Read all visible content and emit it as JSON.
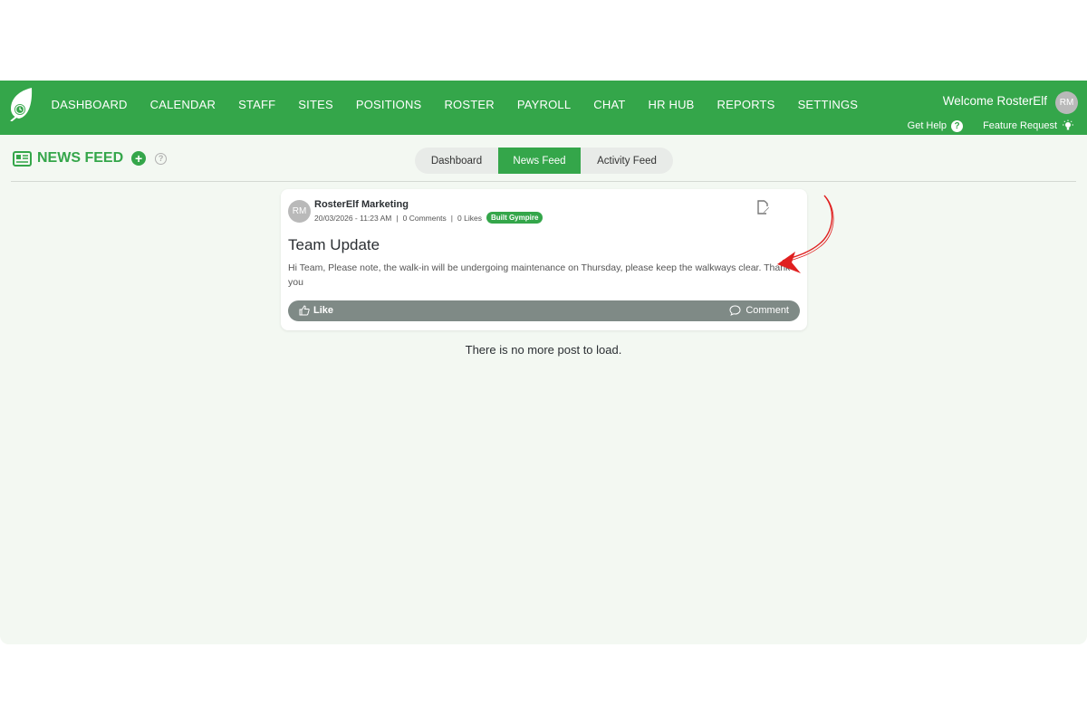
{
  "nav": {
    "items": [
      "DASHBOARD",
      "CALENDAR",
      "STAFF",
      "SITES",
      "POSITIONS",
      "ROSTER",
      "PAYROLL",
      "CHAT",
      "HR HUB",
      "REPORTS",
      "SETTINGS"
    ]
  },
  "user": {
    "welcome": "Welcome RosterElf",
    "initials": "RM"
  },
  "help": {
    "get_help": "Get Help",
    "feature_request": "Feature Request"
  },
  "page": {
    "title": "NEWS FEED"
  },
  "tabs": [
    "Dashboard",
    "News Feed",
    "Activity Feed"
  ],
  "post": {
    "avatar_initials": "RM",
    "author": "RosterElf Marketing",
    "date": "20/03/2026 - 11:23 AM",
    "comments": "0 Comments",
    "likes": "0 Likes",
    "site_badge": "Built Gympire",
    "title": "Team Update",
    "body": "Hi Team, Please note, the walk-in will be undergoing maintenance on Thursday, please keep the walkways clear. Thank you",
    "like_label": "Like",
    "comment_label": "Comment"
  },
  "footer_message": "There is no more post to load.",
  "colors": {
    "brand_green": "#34a64a",
    "background": "#f3f8f2",
    "action_bar": "#7f8a86",
    "annotation_arrow": "#e02020"
  }
}
